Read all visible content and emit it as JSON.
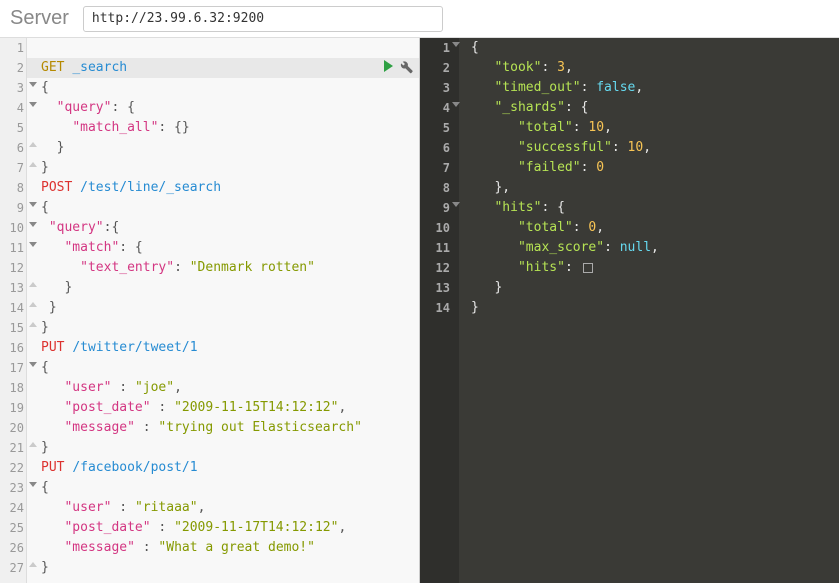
{
  "header": {
    "server_label": "Server",
    "server_url": "http://23.99.6.32:9200"
  },
  "editor": {
    "active_line": 2,
    "lines": [
      {
        "n": 1,
        "tokens": []
      },
      {
        "n": 2,
        "tokens": [
          {
            "t": "GET",
            "c": "kw-get"
          },
          {
            "t": " "
          },
          {
            "t": "_search",
            "c": "path"
          }
        ],
        "active": true,
        "actions": true
      },
      {
        "n": 3,
        "fold": true,
        "tokens": [
          {
            "t": "{",
            "c": "punc"
          }
        ]
      },
      {
        "n": 4,
        "fold": true,
        "tokens": [
          {
            "t": "  "
          },
          {
            "t": "\"query\"",
            "c": "str-key"
          },
          {
            "t": ": {",
            "c": "punc"
          }
        ]
      },
      {
        "n": 5,
        "tokens": [
          {
            "t": "    "
          },
          {
            "t": "\"match_all\"",
            "c": "str-key"
          },
          {
            "t": ": {}",
            "c": "punc"
          }
        ]
      },
      {
        "n": 6,
        "fold_up": true,
        "tokens": [
          {
            "t": "  }",
            "c": "punc"
          }
        ]
      },
      {
        "n": 7,
        "fold_up": true,
        "tokens": [
          {
            "t": "}",
            "c": "punc"
          }
        ]
      },
      {
        "n": 8,
        "tokens": [
          {
            "t": "POST",
            "c": "kw-post"
          },
          {
            "t": " "
          },
          {
            "t": "/test/line/_search",
            "c": "path"
          }
        ]
      },
      {
        "n": 9,
        "fold": true,
        "tokens": [
          {
            "t": "{",
            "c": "punc"
          }
        ]
      },
      {
        "n": 10,
        "fold": true,
        "tokens": [
          {
            "t": " "
          },
          {
            "t": "\"query\"",
            "c": "str-key"
          },
          {
            "t": ":{",
            "c": "punc"
          }
        ]
      },
      {
        "n": 11,
        "fold": true,
        "tokens": [
          {
            "t": "   "
          },
          {
            "t": "\"match\"",
            "c": "str-key"
          },
          {
            "t": ": {",
            "c": "punc"
          }
        ]
      },
      {
        "n": 12,
        "tokens": [
          {
            "t": "     "
          },
          {
            "t": "\"text_entry\"",
            "c": "str-key"
          },
          {
            "t": ": ",
            "c": "punc"
          },
          {
            "t": "\"Denmark rotten\"",
            "c": "str-val"
          }
        ]
      },
      {
        "n": 13,
        "fold_up": true,
        "tokens": [
          {
            "t": "   }",
            "c": "punc"
          }
        ]
      },
      {
        "n": 14,
        "fold_up": true,
        "tokens": [
          {
            "t": " }",
            "c": "punc"
          }
        ]
      },
      {
        "n": 15,
        "fold_up": true,
        "tokens": [
          {
            "t": "}",
            "c": "punc"
          }
        ]
      },
      {
        "n": 16,
        "tokens": [
          {
            "t": "PUT",
            "c": "kw-put"
          },
          {
            "t": " "
          },
          {
            "t": "/twitter/tweet/1",
            "c": "path"
          }
        ]
      },
      {
        "n": 17,
        "fold": true,
        "tokens": [
          {
            "t": "{",
            "c": "punc"
          }
        ]
      },
      {
        "n": 18,
        "tokens": [
          {
            "t": "   "
          },
          {
            "t": "\"user\"",
            "c": "str-key"
          },
          {
            "t": " : ",
            "c": "punc"
          },
          {
            "t": "\"joe\"",
            "c": "str-val"
          },
          {
            "t": ",",
            "c": "punc"
          }
        ]
      },
      {
        "n": 19,
        "tokens": [
          {
            "t": "   "
          },
          {
            "t": "\"post_date\"",
            "c": "str-key"
          },
          {
            "t": " : ",
            "c": "punc"
          },
          {
            "t": "\"2009-11-15T14:12:12\"",
            "c": "str-val"
          },
          {
            "t": ",",
            "c": "punc"
          }
        ]
      },
      {
        "n": 20,
        "tokens": [
          {
            "t": "   "
          },
          {
            "t": "\"message\"",
            "c": "str-key"
          },
          {
            "t": " : ",
            "c": "punc"
          },
          {
            "t": "\"trying out Elasticsearch\"",
            "c": "str-val"
          }
        ]
      },
      {
        "n": 21,
        "fold_up": true,
        "tokens": [
          {
            "t": "}",
            "c": "punc"
          }
        ]
      },
      {
        "n": 22,
        "tokens": [
          {
            "t": "PUT",
            "c": "kw-put"
          },
          {
            "t": " "
          },
          {
            "t": "/facebook/post/1",
            "c": "path"
          }
        ]
      },
      {
        "n": 23,
        "fold": true,
        "tokens": [
          {
            "t": "{",
            "c": "punc"
          }
        ]
      },
      {
        "n": 24,
        "tokens": [
          {
            "t": "   "
          },
          {
            "t": "\"user\"",
            "c": "str-key"
          },
          {
            "t": " : ",
            "c": "punc"
          },
          {
            "t": "\"ritaaa\"",
            "c": "str-val"
          },
          {
            "t": ",",
            "c": "punc"
          }
        ]
      },
      {
        "n": 25,
        "tokens": [
          {
            "t": "   "
          },
          {
            "t": "\"post_date\"",
            "c": "str-key"
          },
          {
            "t": " : ",
            "c": "punc"
          },
          {
            "t": "\"2009-11-17T14:12:12\"",
            "c": "str-val"
          },
          {
            "t": ",",
            "c": "punc"
          }
        ]
      },
      {
        "n": 26,
        "tokens": [
          {
            "t": "   "
          },
          {
            "t": "\"message\"",
            "c": "str-key"
          },
          {
            "t": " : ",
            "c": "punc"
          },
          {
            "t": "\"What a great demo!\"",
            "c": "str-val"
          }
        ]
      },
      {
        "n": 27,
        "fold_up": true,
        "tokens": [
          {
            "t": "}",
            "c": "punc"
          }
        ]
      }
    ]
  },
  "response": {
    "lines": [
      {
        "n": 1,
        "fold": true,
        "tokens": [
          {
            "t": "{",
            "c": "r-punc"
          }
        ]
      },
      {
        "n": 2,
        "tokens": [
          {
            "t": "   "
          },
          {
            "t": "\"took\"",
            "c": "r-key"
          },
          {
            "t": ": ",
            "c": "r-punc"
          },
          {
            "t": "3",
            "c": "r-num"
          },
          {
            "t": ",",
            "c": "r-punc"
          }
        ]
      },
      {
        "n": 3,
        "tokens": [
          {
            "t": "   "
          },
          {
            "t": "\"timed_out\"",
            "c": "r-key"
          },
          {
            "t": ": ",
            "c": "r-punc"
          },
          {
            "t": "false",
            "c": "r-bool"
          },
          {
            "t": ",",
            "c": "r-punc"
          }
        ]
      },
      {
        "n": 4,
        "fold": true,
        "tokens": [
          {
            "t": "   "
          },
          {
            "t": "\"_shards\"",
            "c": "r-key"
          },
          {
            "t": ": {",
            "c": "r-punc"
          }
        ]
      },
      {
        "n": 5,
        "tokens": [
          {
            "t": "      "
          },
          {
            "t": "\"total\"",
            "c": "r-key"
          },
          {
            "t": ": ",
            "c": "r-punc"
          },
          {
            "t": "10",
            "c": "r-num"
          },
          {
            "t": ",",
            "c": "r-punc"
          }
        ]
      },
      {
        "n": 6,
        "tokens": [
          {
            "t": "      "
          },
          {
            "t": "\"successful\"",
            "c": "r-key"
          },
          {
            "t": ": ",
            "c": "r-punc"
          },
          {
            "t": "10",
            "c": "r-num"
          },
          {
            "t": ",",
            "c": "r-punc"
          }
        ]
      },
      {
        "n": 7,
        "tokens": [
          {
            "t": "      "
          },
          {
            "t": "\"failed\"",
            "c": "r-key"
          },
          {
            "t": ": ",
            "c": "r-punc"
          },
          {
            "t": "0",
            "c": "r-num"
          }
        ]
      },
      {
        "n": 8,
        "tokens": [
          {
            "t": "   },",
            "c": "r-punc"
          }
        ]
      },
      {
        "n": 9,
        "fold": true,
        "tokens": [
          {
            "t": "   "
          },
          {
            "t": "\"hits\"",
            "c": "r-key"
          },
          {
            "t": ": {",
            "c": "r-punc"
          }
        ]
      },
      {
        "n": 10,
        "tokens": [
          {
            "t": "      "
          },
          {
            "t": "\"total\"",
            "c": "r-key"
          },
          {
            "t": ": ",
            "c": "r-punc"
          },
          {
            "t": "0",
            "c": "r-num"
          },
          {
            "t": ",",
            "c": "r-punc"
          }
        ]
      },
      {
        "n": 11,
        "tokens": [
          {
            "t": "      "
          },
          {
            "t": "\"max_score\"",
            "c": "r-key"
          },
          {
            "t": ": ",
            "c": "r-punc"
          },
          {
            "t": "null",
            "c": "r-null"
          },
          {
            "t": ",",
            "c": "r-punc"
          }
        ]
      },
      {
        "n": 12,
        "tokens": [
          {
            "t": "      "
          },
          {
            "t": "\"hits\"",
            "c": "r-key"
          },
          {
            "t": ": ",
            "c": "r-punc"
          },
          {
            "t": "",
            "box": true
          }
        ]
      },
      {
        "n": 13,
        "tokens": [
          {
            "t": "   }",
            "c": "r-punc"
          }
        ]
      },
      {
        "n": 14,
        "tokens": [
          {
            "t": "}",
            "c": "r-punc"
          }
        ]
      }
    ]
  }
}
